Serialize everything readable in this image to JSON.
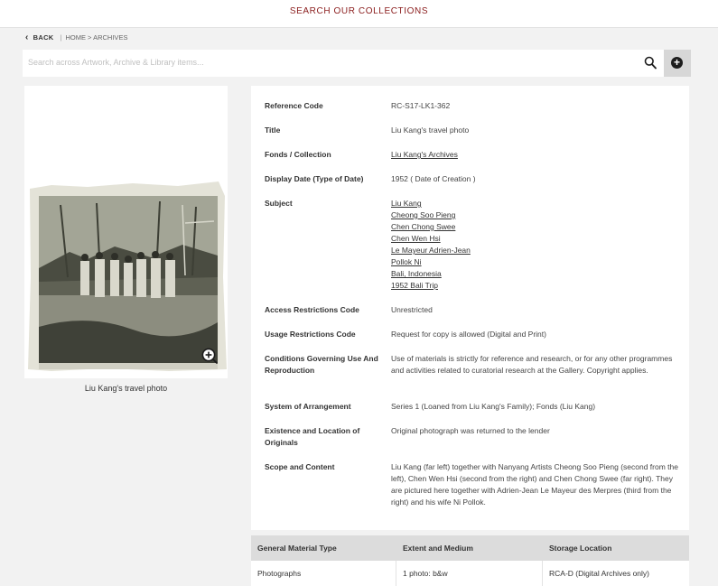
{
  "header": {
    "nav_link": "SEARCH OUR COLLECTIONS"
  },
  "breadcrumb": {
    "back_label": "BACK",
    "separator": "|",
    "path": "HOME > ARCHIVES"
  },
  "search": {
    "placeholder": "Search across Artwork, Archive & Library items..."
  },
  "image": {
    "caption": "Liu Kang's travel photo"
  },
  "details": [
    {
      "label": "Reference Code",
      "value": "RC-S17-LK1-362"
    },
    {
      "label": "Title",
      "value": "Liu Kang's travel photo"
    },
    {
      "label": "Fonds / Collection",
      "links": [
        "Liu Kang's Archives"
      ]
    },
    {
      "label": "Display Date (Type of Date)",
      "value": "1952 ( Date of Creation )"
    },
    {
      "label": "Subject",
      "links": [
        "Liu Kang",
        "Cheong Soo Pieng",
        "Chen Chong Swee",
        "Chen Wen Hsi",
        "Le Mayeur Adrien-Jean",
        "Pollok Ni",
        "Bali, Indonesia",
        "1952 Bali Trip"
      ]
    },
    {
      "label": "Access Restrictions Code",
      "value": "Unrestricted"
    },
    {
      "label": "Usage Restrictions Code",
      "value": "Request for copy is allowed (Digital and Print)"
    },
    {
      "label": "Conditions Governing Use And Reproduction",
      "value": "Use of materials is strictly for reference and research, or for any other programmes and activities related to curatorial research at the Gallery. Copyright applies."
    },
    {
      "label": "System of Arrangement",
      "value": "Series 1 (Loaned from Liu Kang's Family); Fonds (Liu Kang)"
    },
    {
      "label": "Existence and Location of Originals",
      "value": "Original photograph was returned to the lender"
    },
    {
      "label": "Scope and Content",
      "value": "Liu Kang (far left) together with Nanyang Artists Cheong Soo Pieng (second from the left), Chen Wen Hsi (second from the right) and Chen Chong Swee (far right). They are pictured here together with Adrien-Jean Le Mayeur des Merpres (third from the right) and his wife Ni Pollok."
    }
  ],
  "table": {
    "headers": [
      "General Material Type",
      "Extent and Medium",
      "Storage Location"
    ],
    "rows": [
      [
        "Photographs",
        "1 photo: b&w",
        "RCA-D (Digital Archives only)"
      ]
    ]
  },
  "colors": {
    "accent": "#8a1c1c",
    "panel": "#ffffff",
    "background": "#f2f2f2",
    "table_header": "#dcdcdc"
  },
  "icons": {
    "back": "chevron-left-icon",
    "search": "search-icon",
    "add": "plus-circle-icon",
    "zoom": "zoom-in-icon"
  }
}
